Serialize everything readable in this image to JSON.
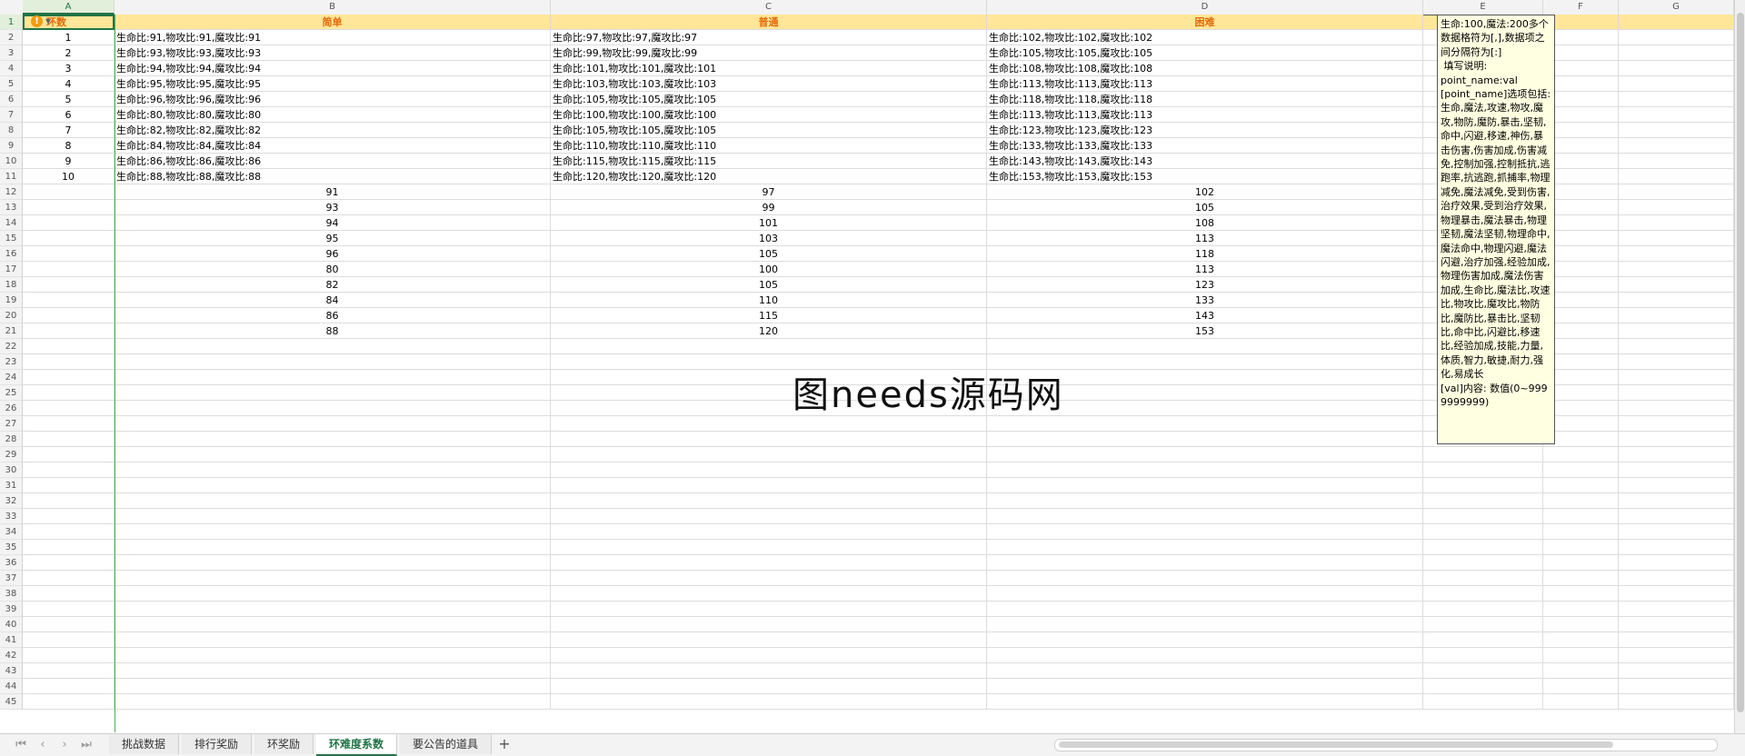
{
  "columns": [
    "A",
    "B",
    "C",
    "D",
    "E",
    "F",
    "G"
  ],
  "row_numbers": [
    "1",
    "2",
    "3",
    "4",
    "5",
    "6",
    "7",
    "8",
    "9",
    "10",
    "11",
    "12",
    "13",
    "14",
    "15",
    "16",
    "17",
    "18",
    "19",
    "20",
    "21",
    "22",
    "23",
    "24",
    "25",
    "26",
    "27",
    "28",
    "29",
    "30",
    "31",
    "32",
    "33",
    "34",
    "35",
    "36",
    "37",
    "38",
    "39",
    "40",
    "41",
    "42",
    "43",
    "44",
    "45"
  ],
  "headers": {
    "a": "环数",
    "b": "简单",
    "c": "普通",
    "d": "困难"
  },
  "warning_icon": "!",
  "rows": [
    {
      "a": "1",
      "b": "生命比:91,物攻比:91,魔攻比:91",
      "c": "生命比:97,物攻比:97,魔攻比:97",
      "d": "生命比:102,物攻比:102,魔攻比:102"
    },
    {
      "a": "2",
      "b": "生命比:93,物攻比:93,魔攻比:93",
      "c": "生命比:99,物攻比:99,魔攻比:99",
      "d": "生命比:105,物攻比:105,魔攻比:105"
    },
    {
      "a": "3",
      "b": "生命比:94,物攻比:94,魔攻比:94",
      "c": "生命比:101,物攻比:101,魔攻比:101",
      "d": "生命比:108,物攻比:108,魔攻比:108"
    },
    {
      "a": "4",
      "b": "生命比:95,物攻比:95,魔攻比:95",
      "c": "生命比:103,物攻比:103,魔攻比:103",
      "d": "生命比:113,物攻比:113,魔攻比:113"
    },
    {
      "a": "5",
      "b": "生命比:96,物攻比:96,魔攻比:96",
      "c": "生命比:105,物攻比:105,魔攻比:105",
      "d": "生命比:118,物攻比:118,魔攻比:118"
    },
    {
      "a": "6",
      "b": "生命比:80,物攻比:80,魔攻比:80",
      "c": "生命比:100,物攻比:100,魔攻比:100",
      "d": "生命比:113,物攻比:113,魔攻比:113"
    },
    {
      "a": "7",
      "b": "生命比:82,物攻比:82,魔攻比:82",
      "c": "生命比:105,物攻比:105,魔攻比:105",
      "d": "生命比:123,物攻比:123,魔攻比:123"
    },
    {
      "a": "8",
      "b": "生命比:84,物攻比:84,魔攻比:84",
      "c": "生命比:110,物攻比:110,魔攻比:110",
      "d": "生命比:133,物攻比:133,魔攻比:133"
    },
    {
      "a": "9",
      "b": "生命比:86,物攻比:86,魔攻比:86",
      "c": "生命比:115,物攻比:115,魔攻比:115",
      "d": "生命比:143,物攻比:143,魔攻比:143"
    },
    {
      "a": "10",
      "b": "生命比:88,物攻比:88,魔攻比:88",
      "c": "生命比:120,物攻比:120,魔攻比:120",
      "d": "生命比:153,物攻比:153,魔攻比:153"
    },
    {
      "a": "",
      "b": "91",
      "c": "97",
      "d": "102"
    },
    {
      "a": "",
      "b": "93",
      "c": "99",
      "d": "105"
    },
    {
      "a": "",
      "b": "94",
      "c": "101",
      "d": "108"
    },
    {
      "a": "",
      "b": "95",
      "c": "103",
      "d": "113"
    },
    {
      "a": "",
      "b": "96",
      "c": "105",
      "d": "118"
    },
    {
      "a": "",
      "b": "80",
      "c": "100",
      "d": "113"
    },
    {
      "a": "",
      "b": "82",
      "c": "105",
      "d": "123"
    },
    {
      "a": "",
      "b": "84",
      "c": "110",
      "d": "133"
    },
    {
      "a": "",
      "b": "86",
      "c": "115",
      "d": "143"
    },
    {
      "a": "",
      "b": "88",
      "c": "120",
      "d": "153"
    }
  ],
  "comment_text": "生命:100,魔法:200多个数据格符为[,],数据项之间分隔符为[:]\n 填写说明:\npoint_name:val\n[point_name]选项包括:生命,魔法,攻速,物攻,魔攻,物防,魔防,暴击,坚韧,命中,闪避,移速,神伤,暴击伤害,伤害加成,伤害减免,控制加强,控制抵抗,逃跑率,抗逃跑,抓捕率,物理减免,魔法减免,受到伤害,治疗效果,受到治疗效果,物理暴击,魔法暴击,物理坚韧,魔法坚韧,物理命中,魔法命中,物理闪避,魔法闪避,治疗加强,经验加成,物理伤害加成,魔法伤害加成,生命比,魔法比,攻速比,物攻比,魔攻比,物防比,魔防比,暴击比,坚韧比,命中比,闪避比,移速比,经验加成,技能,力量,体质,智力,敏捷,耐力,强化,易成长\n[val]内容: 数值(0~9999999999)",
  "watermark": "图needs源码网",
  "sheet_tabs": [
    "挑战数据",
    "排行奖励",
    "环奖励",
    "环难度系数",
    "要公告的道具"
  ],
  "active_tab": "环难度系数",
  "colors": {
    "header_fill": "#ffe699",
    "header_text": "#e26b0a",
    "accent": "#217346"
  }
}
